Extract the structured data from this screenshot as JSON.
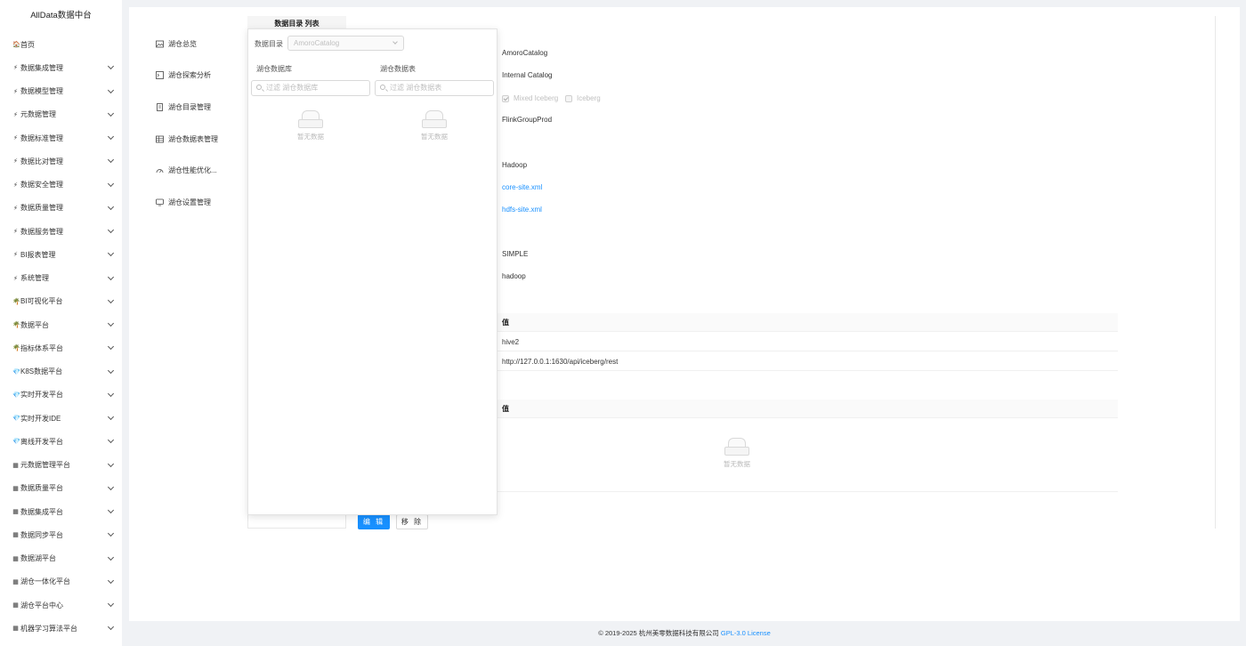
{
  "app": {
    "title": "AllData数据中台"
  },
  "sidebar": {
    "items": [
      {
        "label": "首页",
        "icon": "house-icon",
        "glyph": "🏠",
        "chevron": false
      },
      {
        "label": "数据集成管理",
        "icon": "bolt-icon",
        "glyph": "⚡",
        "chevron": true
      },
      {
        "label": "数据模型管理",
        "icon": "bolt-icon",
        "glyph": "⚡",
        "chevron": true
      },
      {
        "label": "元数据管理",
        "icon": "bolt-icon",
        "glyph": "⚡",
        "chevron": true
      },
      {
        "label": "数据标准管理",
        "icon": "bolt-icon",
        "glyph": "⚡",
        "chevron": true
      },
      {
        "label": "数据比对管理",
        "icon": "bolt-icon",
        "glyph": "⚡",
        "chevron": true
      },
      {
        "label": "数据安全管理",
        "icon": "bolt-icon",
        "glyph": "⚡",
        "chevron": true
      },
      {
        "label": "数据质量管理",
        "icon": "bolt-icon",
        "glyph": "⚡",
        "chevron": true
      },
      {
        "label": "数据服务管理",
        "icon": "bolt-icon",
        "glyph": "⚡",
        "chevron": true
      },
      {
        "label": "BI报表管理",
        "icon": "bolt-icon",
        "glyph": "⚡",
        "chevron": true
      },
      {
        "label": "系统管理",
        "icon": "bolt-icon",
        "glyph": "⚡",
        "chevron": true
      },
      {
        "label": "BI可视化平台",
        "icon": "tree-icon",
        "glyph": "🌴",
        "chevron": true
      },
      {
        "label": "数据平台",
        "icon": "tree-icon",
        "glyph": "🌴",
        "chevron": true
      },
      {
        "label": "指标体系平台",
        "icon": "tree-icon",
        "glyph": "🌴",
        "chevron": true
      },
      {
        "label": "K8S数据平台",
        "icon": "diamond-icon",
        "glyph": "💎",
        "chevron": true
      },
      {
        "label": "实时开发平台",
        "icon": "diamond-icon",
        "glyph": "💎",
        "chevron": true
      },
      {
        "label": "实时开发IDE",
        "icon": "diamond-icon",
        "glyph": "💎",
        "chevron": true
      },
      {
        "label": "离线开发平台",
        "icon": "diamond-icon",
        "glyph": "💎",
        "chevron": true
      },
      {
        "label": "元数据管理平台",
        "icon": "grid-icon",
        "glyph": "▦",
        "chevron": true
      },
      {
        "label": "数据质量平台",
        "icon": "grid-icon",
        "glyph": "▦",
        "chevron": true
      },
      {
        "label": "数据集成平台",
        "icon": "grid-icon",
        "glyph": "▦",
        "chevron": true
      },
      {
        "label": "数据同步平台",
        "icon": "grid-icon",
        "glyph": "▦",
        "chevron": true
      },
      {
        "label": "数据湖平台",
        "icon": "grid-icon",
        "glyph": "▦",
        "chevron": true
      },
      {
        "label": "湖仓一体化平台",
        "icon": "grid-icon",
        "glyph": "▦",
        "chevron": true
      },
      {
        "label": "湖仓平台中心",
        "icon": "grid-icon",
        "glyph": "▦",
        "chevron": true
      },
      {
        "label": "机器学习算法平台",
        "icon": "grid-icon",
        "glyph": "▦",
        "chevron": true
      }
    ]
  },
  "lake_menu": {
    "items": [
      {
        "label": "湖仓总览",
        "icon": "image-icon"
      },
      {
        "label": "湖仓探索分析",
        "icon": "terminal-icon"
      },
      {
        "label": "湖仓目录管理",
        "icon": "document-icon"
      },
      {
        "label": "湖仓数据表管理",
        "icon": "table-icon"
      },
      {
        "label": "湖仓性能优化...",
        "icon": "gauge-icon"
      },
      {
        "label": "湖仓设置管理",
        "icon": "monitor-icon"
      }
    ]
  },
  "catalog_list": {
    "header": "数据目录 列表"
  },
  "popover": {
    "catalog_label": "数据目录",
    "catalog_value": "AmoroCatalog",
    "db_column_label": "湖仓数据库",
    "table_column_label": "湖仓数据表",
    "db_search_placeholder": "过滤 湖仓数据库",
    "table_search_placeholder": "过滤 湖仓数据表",
    "empty_text": "暂无数据"
  },
  "details": {
    "name": "AmoroCatalog",
    "type": "Internal Catalog",
    "formats": [
      {
        "label": "Mixed Iceberg",
        "checked": true
      },
      {
        "label": "Iceberg",
        "checked": false
      }
    ],
    "optimizer_group": "FlinkGroupProd",
    "storage_type": "Hadoop",
    "core_site": "core-site.xml",
    "hdfs_site": "hdfs-site.xml",
    "auth_type": "SIMPLE",
    "hadoop_user": "hadoop",
    "properties_table": {
      "value_header": "值",
      "rows": [
        "hive2",
        "http://127.0.0.1:1630/api/iceberg/rest"
      ]
    },
    "table_properties": {
      "value_header": "值",
      "empty_text": "暂无数据"
    }
  },
  "actions": {
    "edit_label": "编 辑",
    "remove_label": "移 除"
  },
  "footer": {
    "copyright": "© 2019-2025 杭州美零数据科技有限公司",
    "license": "GPL-3.0 License"
  }
}
